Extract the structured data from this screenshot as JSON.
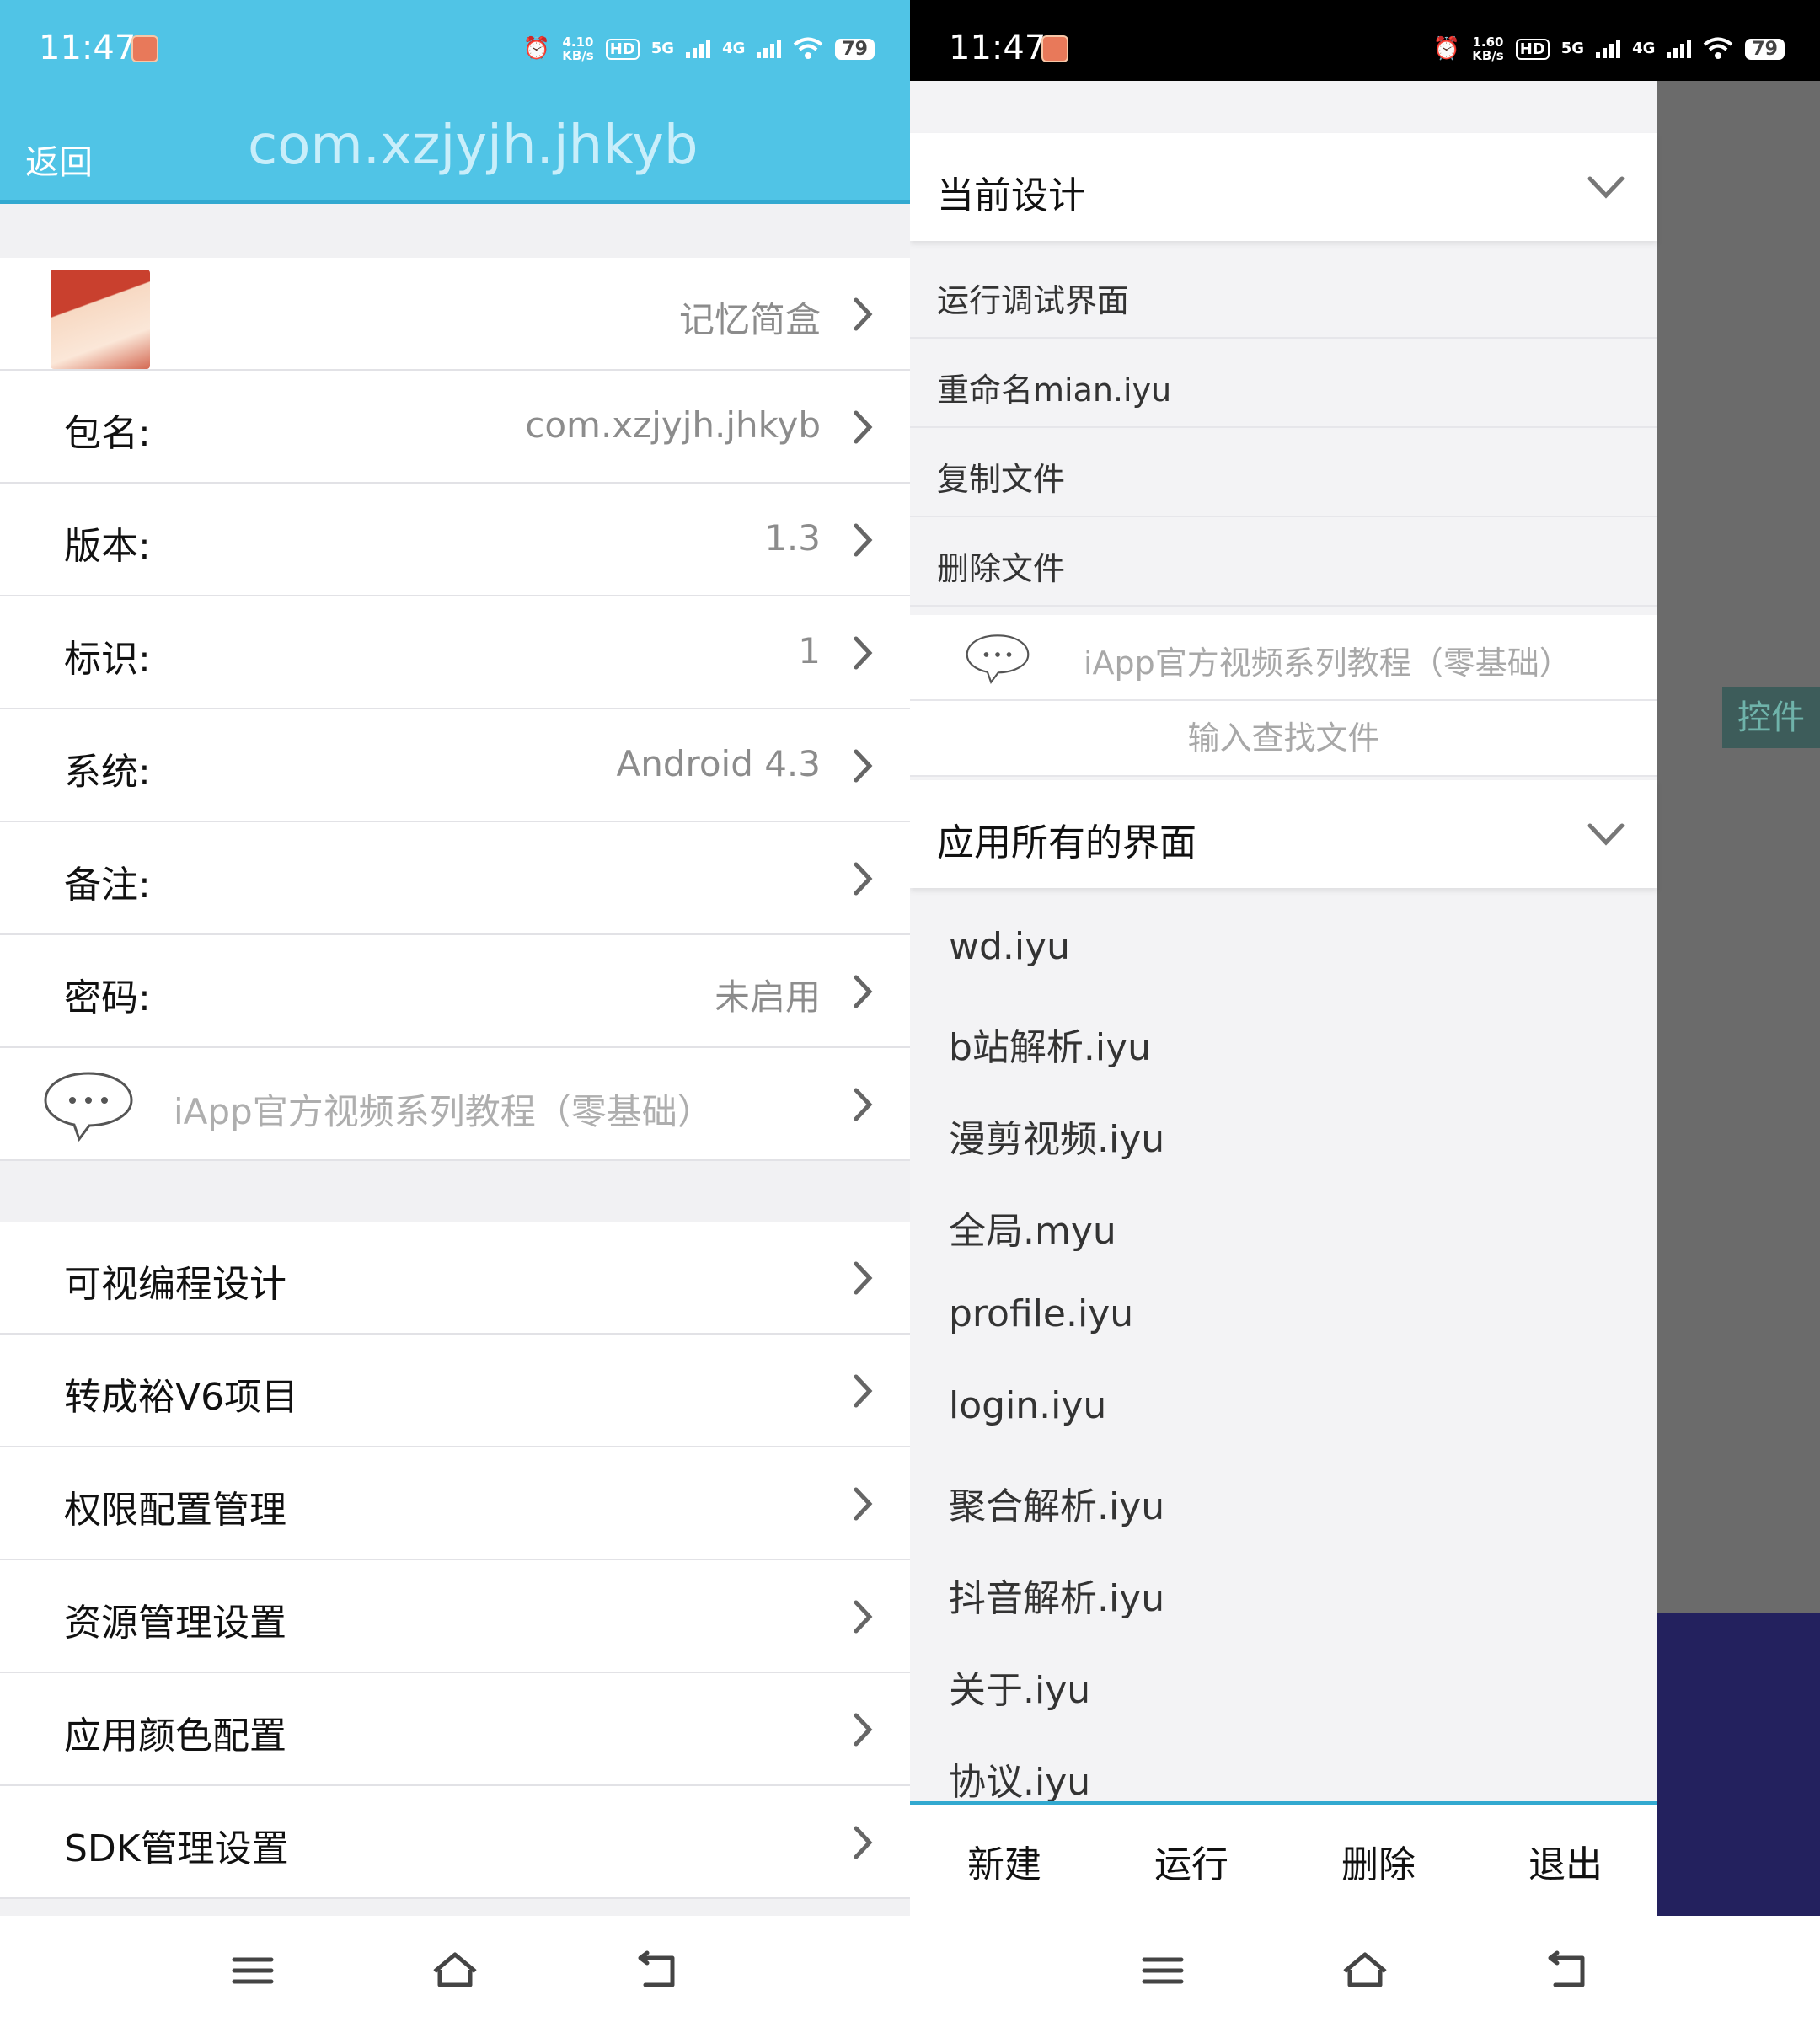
{
  "status_bar": {
    "time": "11:47",
    "left_speed_value": "4.10",
    "right_speed_value": "1.60",
    "speed_unit": "KB/s",
    "hd_label": "HD",
    "net_5g": "5G",
    "net_4g": "4G",
    "battery": "79",
    "icons": [
      "alarm-icon",
      "hd-icon",
      "signal-5g-icon",
      "signal-4g-icon",
      "wifi-icon",
      "battery-icon"
    ]
  },
  "left": {
    "header": {
      "back_label": "返回",
      "title": "com.xzjyjh.jhkyb"
    },
    "app_row": {
      "app_name": "记忆简盒"
    },
    "info_rows": [
      {
        "label": "包名:",
        "value": "com.xzjyjh.jhkyb"
      },
      {
        "label": "版本:",
        "value": "1.3"
      },
      {
        "label": "标识:",
        "value": "1"
      },
      {
        "label": "系统:",
        "value": "Android 4.3"
      },
      {
        "label": "备注:",
        "value": ""
      },
      {
        "label": "密码:",
        "value": "未启用"
      }
    ],
    "tutorial_hint": "iApp官方视频系列教程（零基础）",
    "menu_rows": [
      {
        "label": "可视编程设计"
      },
      {
        "label": "转成裕V6项目"
      },
      {
        "label": "权限配置管理"
      },
      {
        "label": "资源管理设置"
      },
      {
        "label": "应用颜色配置"
      },
      {
        "label": "SDK管理设置"
      }
    ]
  },
  "right": {
    "current_design": {
      "title": "当前设计",
      "items": [
        "运行调试界面",
        "重命名mian.iyu",
        "复制文件",
        "删除文件"
      ]
    },
    "tutorial_hint": "iApp官方视频系列教程（零基础）",
    "search_placeholder": "输入查找文件",
    "all_pages": {
      "title": "应用所有的界面",
      "files": [
        "wd.iyu",
        "b站解析.iyu",
        "漫剪视频.iyu",
        "全局.myu",
        "profile.iyu",
        "login.iyu",
        "聚合解析.iyu",
        "抖音解析.iyu",
        "关于.iyu",
        "协议.iyu"
      ]
    },
    "actions": [
      "新建",
      "运行",
      "删除",
      "退出"
    ],
    "side_tab": "控件"
  },
  "colors": {
    "header_blue": "#50c4e6",
    "accent_line": "#33a9d0",
    "scrim_gray": "#6b6b6b",
    "scrim_navy": "#23215e"
  }
}
